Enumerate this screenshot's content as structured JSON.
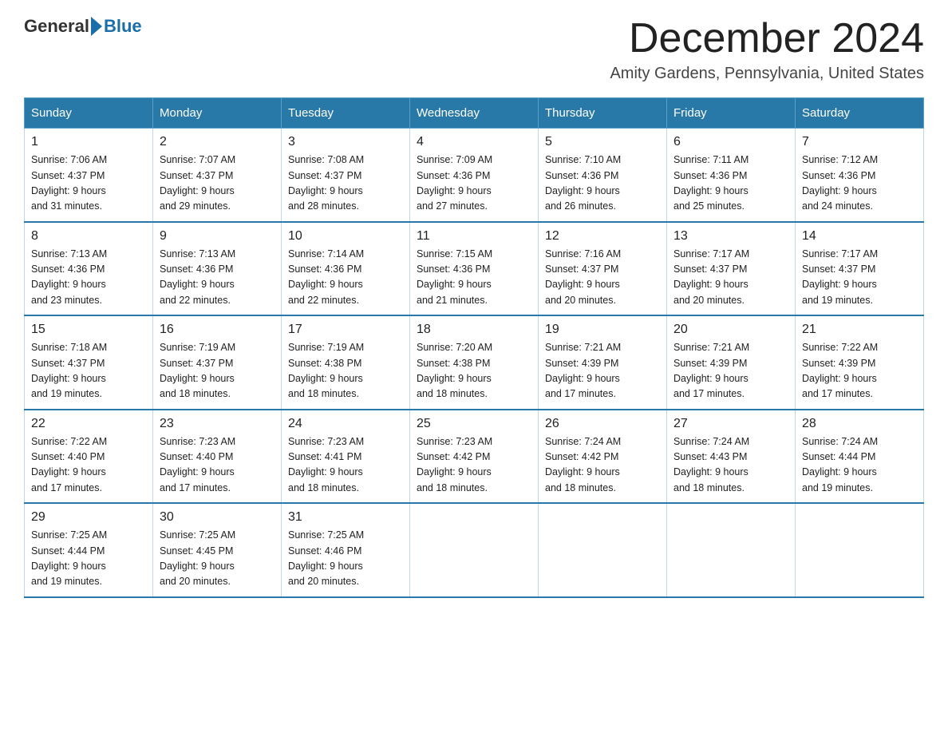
{
  "logo": {
    "general": "General",
    "blue": "Blue"
  },
  "title": "December 2024",
  "location": "Amity Gardens, Pennsylvania, United States",
  "days_of_week": [
    "Sunday",
    "Monday",
    "Tuesday",
    "Wednesday",
    "Thursday",
    "Friday",
    "Saturday"
  ],
  "weeks": [
    [
      {
        "day": "1",
        "sunrise": "7:06 AM",
        "sunset": "4:37 PM",
        "daylight": "9 hours and 31 minutes."
      },
      {
        "day": "2",
        "sunrise": "7:07 AM",
        "sunset": "4:37 PM",
        "daylight": "9 hours and 29 minutes."
      },
      {
        "day": "3",
        "sunrise": "7:08 AM",
        "sunset": "4:37 PM",
        "daylight": "9 hours and 28 minutes."
      },
      {
        "day": "4",
        "sunrise": "7:09 AM",
        "sunset": "4:36 PM",
        "daylight": "9 hours and 27 minutes."
      },
      {
        "day": "5",
        "sunrise": "7:10 AM",
        "sunset": "4:36 PM",
        "daylight": "9 hours and 26 minutes."
      },
      {
        "day": "6",
        "sunrise": "7:11 AM",
        "sunset": "4:36 PM",
        "daylight": "9 hours and 25 minutes."
      },
      {
        "day": "7",
        "sunrise": "7:12 AM",
        "sunset": "4:36 PM",
        "daylight": "9 hours and 24 minutes."
      }
    ],
    [
      {
        "day": "8",
        "sunrise": "7:13 AM",
        "sunset": "4:36 PM",
        "daylight": "9 hours and 23 minutes."
      },
      {
        "day": "9",
        "sunrise": "7:13 AM",
        "sunset": "4:36 PM",
        "daylight": "9 hours and 22 minutes."
      },
      {
        "day": "10",
        "sunrise": "7:14 AM",
        "sunset": "4:36 PM",
        "daylight": "9 hours and 22 minutes."
      },
      {
        "day": "11",
        "sunrise": "7:15 AM",
        "sunset": "4:36 PM",
        "daylight": "9 hours and 21 minutes."
      },
      {
        "day": "12",
        "sunrise": "7:16 AM",
        "sunset": "4:37 PM",
        "daylight": "9 hours and 20 minutes."
      },
      {
        "day": "13",
        "sunrise": "7:17 AM",
        "sunset": "4:37 PM",
        "daylight": "9 hours and 20 minutes."
      },
      {
        "day": "14",
        "sunrise": "7:17 AM",
        "sunset": "4:37 PM",
        "daylight": "9 hours and 19 minutes."
      }
    ],
    [
      {
        "day": "15",
        "sunrise": "7:18 AM",
        "sunset": "4:37 PM",
        "daylight": "9 hours and 19 minutes."
      },
      {
        "day": "16",
        "sunrise": "7:19 AM",
        "sunset": "4:37 PM",
        "daylight": "9 hours and 18 minutes."
      },
      {
        "day": "17",
        "sunrise": "7:19 AM",
        "sunset": "4:38 PM",
        "daylight": "9 hours and 18 minutes."
      },
      {
        "day": "18",
        "sunrise": "7:20 AM",
        "sunset": "4:38 PM",
        "daylight": "9 hours and 18 minutes."
      },
      {
        "day": "19",
        "sunrise": "7:21 AM",
        "sunset": "4:39 PM",
        "daylight": "9 hours and 17 minutes."
      },
      {
        "day": "20",
        "sunrise": "7:21 AM",
        "sunset": "4:39 PM",
        "daylight": "9 hours and 17 minutes."
      },
      {
        "day": "21",
        "sunrise": "7:22 AM",
        "sunset": "4:39 PM",
        "daylight": "9 hours and 17 minutes."
      }
    ],
    [
      {
        "day": "22",
        "sunrise": "7:22 AM",
        "sunset": "4:40 PM",
        "daylight": "9 hours and 17 minutes."
      },
      {
        "day": "23",
        "sunrise": "7:23 AM",
        "sunset": "4:40 PM",
        "daylight": "9 hours and 17 minutes."
      },
      {
        "day": "24",
        "sunrise": "7:23 AM",
        "sunset": "4:41 PM",
        "daylight": "9 hours and 18 minutes."
      },
      {
        "day": "25",
        "sunrise": "7:23 AM",
        "sunset": "4:42 PM",
        "daylight": "9 hours and 18 minutes."
      },
      {
        "day": "26",
        "sunrise": "7:24 AM",
        "sunset": "4:42 PM",
        "daylight": "9 hours and 18 minutes."
      },
      {
        "day": "27",
        "sunrise": "7:24 AM",
        "sunset": "4:43 PM",
        "daylight": "9 hours and 18 minutes."
      },
      {
        "day": "28",
        "sunrise": "7:24 AM",
        "sunset": "4:44 PM",
        "daylight": "9 hours and 19 minutes."
      }
    ],
    [
      {
        "day": "29",
        "sunrise": "7:25 AM",
        "sunset": "4:44 PM",
        "daylight": "9 hours and 19 minutes."
      },
      {
        "day": "30",
        "sunrise": "7:25 AM",
        "sunset": "4:45 PM",
        "daylight": "9 hours and 20 minutes."
      },
      {
        "day": "31",
        "sunrise": "7:25 AM",
        "sunset": "4:46 PM",
        "daylight": "9 hours and 20 minutes."
      },
      null,
      null,
      null,
      null
    ]
  ],
  "labels": {
    "sunrise": "Sunrise:",
    "sunset": "Sunset:",
    "daylight": "Daylight:"
  }
}
